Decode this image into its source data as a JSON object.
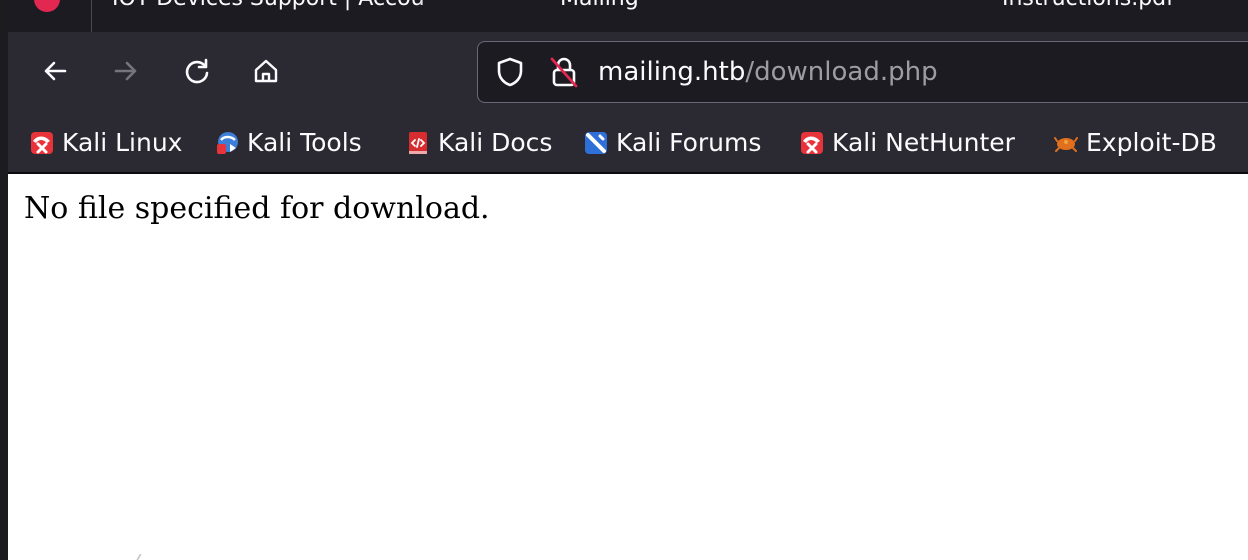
{
  "tabs": [
    {
      "title": "IOT Devices Support | Accou"
    },
    {
      "title": "Mailing"
    },
    {
      "title": "Instructions.pdf"
    }
  ],
  "navigation": {
    "back_icon": "arrow-left-icon",
    "forward_icon": "arrow-right-icon",
    "reload_icon": "reload-icon",
    "home_icon": "home-icon"
  },
  "urlbar": {
    "domain": "mailing.htb",
    "path": "/download.php"
  },
  "bookmarks": [
    {
      "label": "Kali Linux",
      "icon": "kali-linux-icon"
    },
    {
      "label": "Kali Tools",
      "icon": "kali-tools-icon"
    },
    {
      "label": "Kali Docs",
      "icon": "kali-docs-icon"
    },
    {
      "label": "Kali Forums",
      "icon": "kali-forums-icon"
    },
    {
      "label": "Kali NetHunter",
      "icon": "kali-nethunter-icon"
    },
    {
      "label": "Exploit-DB",
      "icon": "exploit-db-icon"
    }
  ],
  "page": {
    "message": "No file specified for download."
  },
  "colors": {
    "chrome_dark": "#1c1b22",
    "toolbar": "#2b2a33",
    "accent": "#e22850",
    "text_light": "#fbfbfe",
    "text_dim": "#9d9ca3"
  }
}
